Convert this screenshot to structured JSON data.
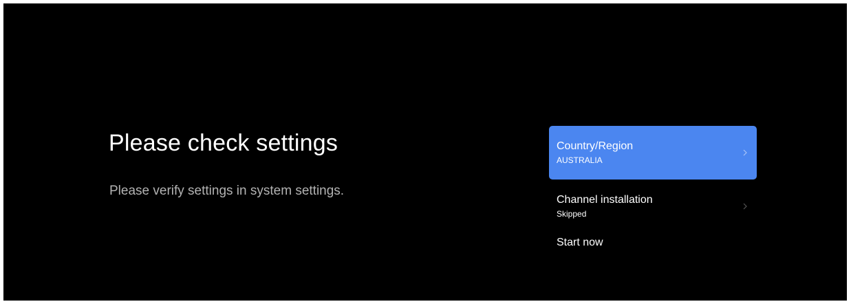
{
  "screen": {
    "title": "Please check settings",
    "subtitle": "Please verify settings in system settings."
  },
  "menu": {
    "items": [
      {
        "label": "Country/Region",
        "value": "AUSTRALIA",
        "icon": "chevron-right-icon",
        "focused": true
      },
      {
        "label": "Channel installation",
        "value": "Skipped",
        "icon": "chevron-right-icon",
        "focused": false
      },
      {
        "label": "Start now"
      }
    ]
  },
  "colors": {
    "background": "#000000",
    "focus_highlight": "#4b86f0",
    "title_text": "#ffffff",
    "subtitle_text": "#b3b3b3"
  }
}
